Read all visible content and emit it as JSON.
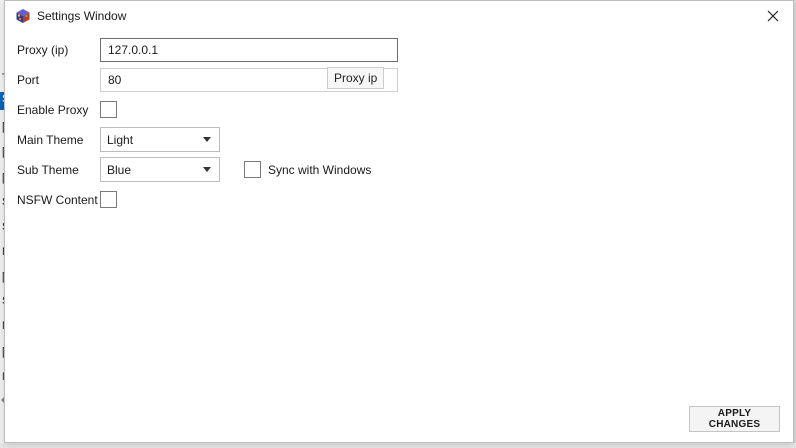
{
  "window": {
    "title": "Settings Window"
  },
  "form": {
    "proxy_ip": {
      "label": "Proxy (ip)",
      "value": "127.0.0.1"
    },
    "port": {
      "label": "Port",
      "value": "80",
      "tooltip": "Proxy ip"
    },
    "enable_proxy": {
      "label": "Enable Proxy",
      "checked": false
    },
    "main_theme": {
      "label": "Main Theme",
      "selected": "Light"
    },
    "sub_theme": {
      "label": "Sub Theme",
      "selected": "Blue"
    },
    "sync_windows": {
      "label": "Sync with Windows",
      "checked": false
    },
    "nsfw": {
      "label": "NSFW Content",
      "checked": false
    }
  },
  "actions": {
    "apply_label": "APPLY CHANGES"
  },
  "background_fragments": [
    "T",
    "S",
    "[",
    "[",
    "[",
    "S",
    "S",
    "N",
    "[",
    "S",
    "N",
    "[",
    "N"
  ],
  "colors": {
    "accent": "#0067c0",
    "window_bg": "#ffffff",
    "button_bg": "#f4f4f4"
  },
  "icons": {
    "app": "cube-app-icon",
    "close": "close-icon",
    "dropdown": "chevron-down-icon"
  }
}
